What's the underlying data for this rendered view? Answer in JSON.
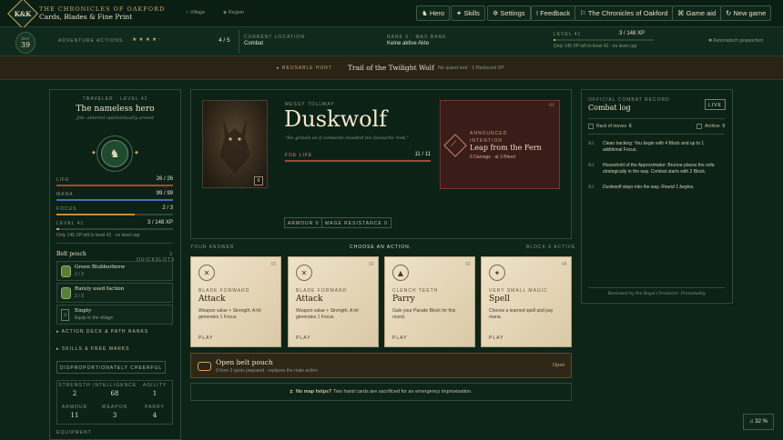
{
  "app": {
    "logo_text": "K&K",
    "title_top": "THE CHRONICLES OF OAKFORD",
    "title_sub": "Cards, Blades & Fine Print"
  },
  "breadcrumb": {
    "village": "○ Village",
    "region": "◈ Region"
  },
  "nav": [
    {
      "icon": "♞",
      "label": "Hero"
    },
    {
      "icon": "✦",
      "label": "Skills"
    },
    {
      "icon": "✲",
      "label": "Settings"
    },
    {
      "icon": "!",
      "label": "Feedback"
    },
    {
      "icon": "⚐",
      "label": "The Chronicles of Oakford"
    },
    {
      "icon": "⌘",
      "label": "Game aid"
    },
    {
      "icon": "↻",
      "label": "New game"
    }
  ],
  "status": {
    "day_label": "DAY",
    "day": "39",
    "actions_label": "ADVENTURE ACTIONS",
    "actions_stars": "★ ★ ★ ★ ·",
    "actions_value": "4 / 5",
    "location_label": "CURRENT LOCATION",
    "location_value": "Combat",
    "rank_label": "RANK 6 · MAX RANK",
    "rank_value": "Keine aktive Akte",
    "level_label": "LEVEL 41",
    "xp_value": "3 / 148 XP",
    "xp_note": "Only 145 XP left to level 42 · no level cap",
    "xp_fraction": 0.02,
    "autosave": "✱ Automatisch gespeichert"
  },
  "hunt": {
    "tag": "▸ REUSABLE HUNT",
    "name": "Trail of the Twilight Wolf",
    "loot": "No quest loot · 1 Reduced XP"
  },
  "hero": {
    "caption": "TRAVELER · LEVEL 41",
    "name": "The nameless hero",
    "job": "Job: entered optimistically armed",
    "life_label": "LIFE",
    "life_value": "26 / 26",
    "life_fraction": 1.0,
    "mana_label": "MANA",
    "mana_value": "99 / 99",
    "mana_fraction": 1.0,
    "focus_label": "FOCUS",
    "focus_value": "2 / 3",
    "focus_fraction": 0.67,
    "level_label": "LEVEL 41",
    "level_xp": "3 / 148 XP",
    "level_note": "Only 145 XP left to level 42 · no level cap",
    "belt_label": "Belt pouch",
    "quickslots": "3 QUICKSLOTS",
    "belt_items": [
      {
        "name": "Green Blubberbrew",
        "count": "1 / 3"
      },
      {
        "name": "Rarely used faction",
        "count": "2 / 3"
      },
      {
        "name": "Empty",
        "count": "Equip in the village"
      }
    ],
    "action_deck": "▸ ACTION DECK & PATH RANKS",
    "skills_free": "▸ SKILLS & FREE MARKS",
    "trait": "DISPROPORTIONATELY CHEERFUL",
    "stats": [
      {
        "label": "STRENGTH",
        "value": "2"
      },
      {
        "label": "INTELLIGENCE",
        "value": "68"
      },
      {
        "label": "AGILITY",
        "value": "1"
      },
      {
        "label": "ARMOUR",
        "value": "11"
      },
      {
        "label": "WEAPON",
        "value": "3"
      },
      {
        "label": "PARRY",
        "value": "4"
      }
    ],
    "equipment": "EQUIPMENT"
  },
  "enemy": {
    "caption": "MESSY TOLLWAY",
    "name": "Duskwolf",
    "quote": "\"He growls as if someone insulted his favourite root.\"",
    "life_label": "FOE LIFE",
    "life_value": "11 / 11",
    "life_fraction": 1.0,
    "portrait_badge": "0",
    "armour": "ARMOUR 0",
    "mage_resistance": "MAGE RESISTANCE 0",
    "intent_num": "01",
    "intent_label": "ANNOUNCED INTENTION",
    "intent_name": "Leap from the Fern",
    "intent_detail": "6 Damage · at 3 Bleed"
  },
  "answer": {
    "left": "YOUR ANSWER",
    "center": "CHOOSE AN ACTION.",
    "right": "BLOCK 6 ACTIVE",
    "cards": [
      {
        "num": "01",
        "icon": "✕",
        "type": "BLADE FORWARD",
        "name": "Attack",
        "text": "Weapon value + Strength. A hit generates 1 Focus.",
        "play": "PLAY"
      },
      {
        "num": "02",
        "icon": "✕",
        "type": "BLADE FORWARD",
        "name": "Attack",
        "text": "Weapon value + Strength. A hit generates 1 Focus.",
        "play": "PLAY"
      },
      {
        "num": "03",
        "icon": "▲",
        "type": "CLENCH TEETH",
        "name": "Parry",
        "text": "Gain your Parade Block for this round.",
        "play": "PLAY"
      },
      {
        "num": "04",
        "icon": "✦",
        "type": "VERY SMALL MAGIC",
        "name": "Spell",
        "text": "Choose a learned spell and pay mana.",
        "play": "PLAY"
      }
    ],
    "belt_title": "Open belt pouch",
    "belt_sub": "0 from 3 spots prepared · replaces the main action",
    "belt_action": "Open",
    "hint_bold": "No map helps?",
    "hint": "Two hand cards are sacrificed for an emergency improvisation."
  },
  "log": {
    "caption": "OFFICIAL COMBAT RECORD",
    "title": "Combat log",
    "live": "LIVE",
    "rack_label": "Rack of moves",
    "rack_count": "6",
    "archive_label": "Archive",
    "archive_count": "0",
    "entries": [
      {
        "round": "R1",
        "text": "Clean tracking: You begin with 4 Block and up to 1 additional Focus."
      },
      {
        "round": "R1",
        "text": "Household of the Approximator: Brunna places the sofa strategically in the way. Combat starts with 2 Block."
      },
      {
        "round": "R1",
        "text": "Duskwolf steps into the way. Round 1 begins."
      }
    ],
    "footer": "Reviewed by the Royal Chronicler. Presumably."
  },
  "volume": {
    "icon": "♫",
    "value": "32 %"
  },
  "colors": {
    "gold": "#c9a664",
    "life": "#a8453a",
    "mana": "#4f6db0",
    "focus": "#c98a3a",
    "panel": "#0c2217"
  }
}
